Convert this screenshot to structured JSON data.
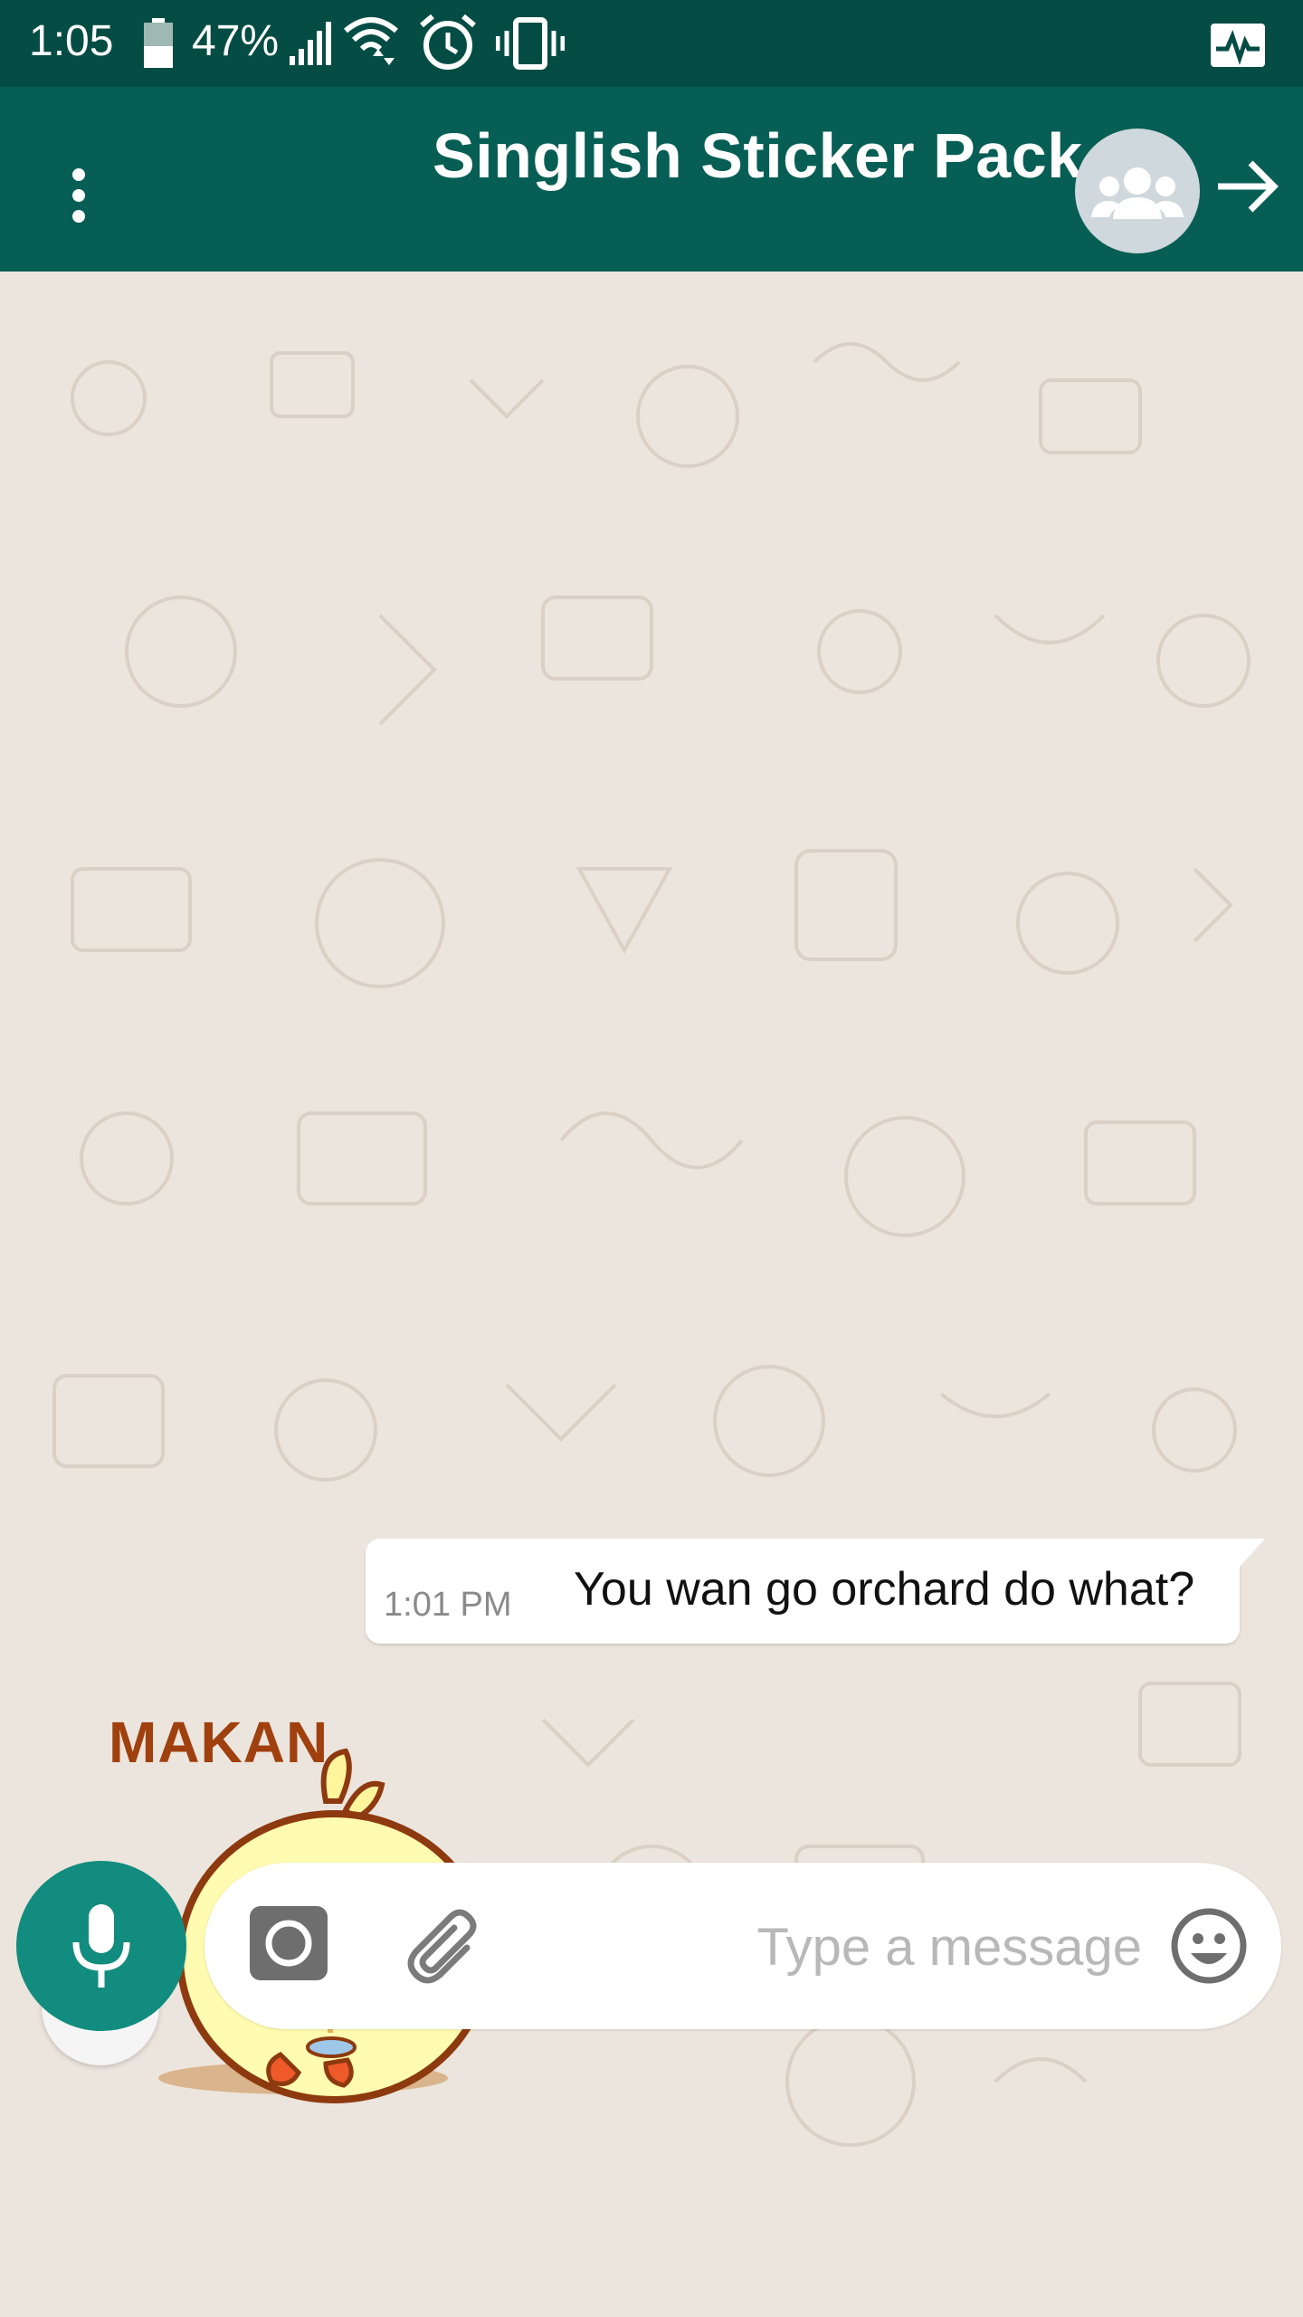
{
  "status_bar": {
    "time": "1:05",
    "battery_percent": "47%",
    "battery_level": 0.47,
    "icons": [
      "battery-icon",
      "signal-icon",
      "wifi-icon",
      "alarm-icon",
      "vibrate-icon",
      "activity-monitor-icon"
    ]
  },
  "app_bar": {
    "title": "Singlish Sticker Pack",
    "icons": [
      "more-vert-icon",
      "group-avatar-icon",
      "arrow-forward-icon"
    ],
    "color": "#075e54"
  },
  "chat": {
    "messages": [
      {
        "text": "You wan go orchard do what?",
        "time": "1:01 PM",
        "direction": "outgoing"
      }
    ],
    "sticker": {
      "label": "MAKAN",
      "description_icon": "chick-sticker"
    }
  },
  "composer": {
    "placeholder": "Type a message",
    "value": "",
    "icons": [
      "mic-icon",
      "camera-icon",
      "attach-icon",
      "emoji-icon",
      "chevron-double-down-icon"
    ],
    "accent": "#128c7e"
  }
}
